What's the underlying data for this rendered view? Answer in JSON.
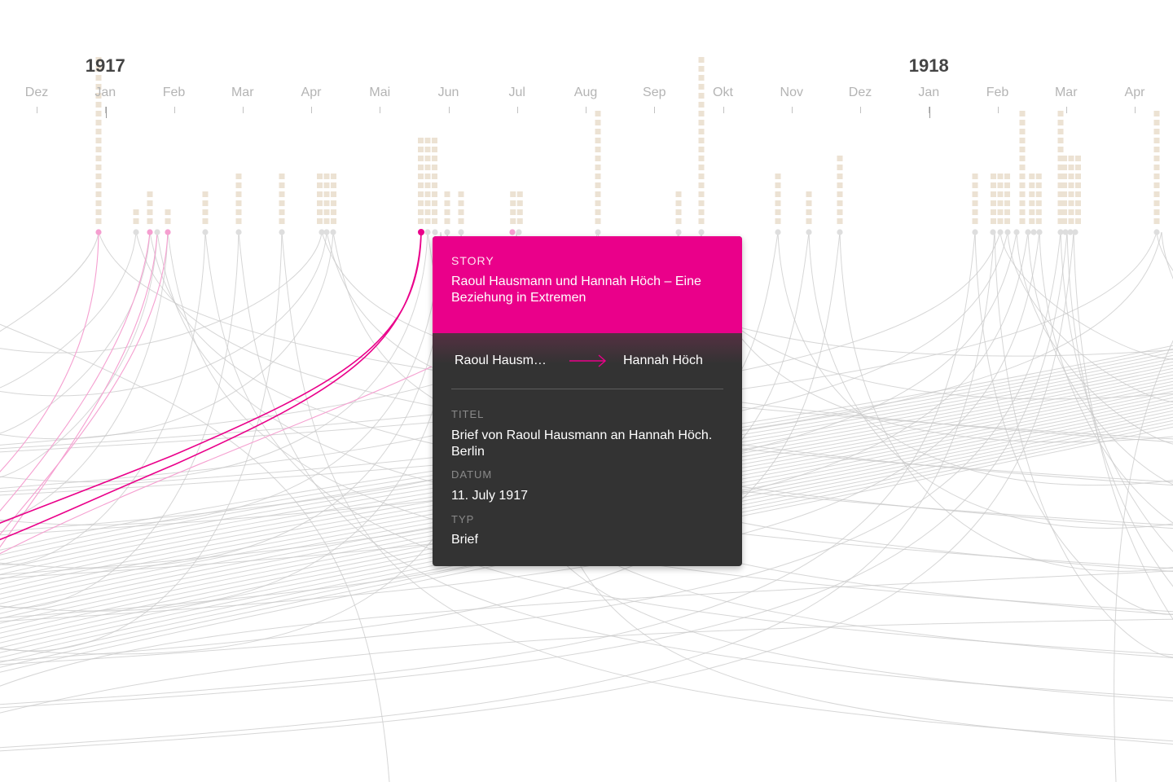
{
  "timeline": {
    "years": [
      {
        "label": "1917",
        "month_index": 1
      },
      {
        "label": "1918",
        "month_index": 13
      }
    ],
    "months": [
      "Dez",
      "Jan",
      "Feb",
      "Mar",
      "Apr",
      "Mai",
      "Jun",
      "Jul",
      "Aug",
      "Sep",
      "Okt",
      "Nov",
      "Dez",
      "Jan",
      "Feb",
      "Mar",
      "Apr"
    ]
  },
  "colors": {
    "accent": "#ea008a",
    "accent_light": "#f59fd0",
    "line_gray": "#c8c8c8",
    "square_beige": "#ece2d3",
    "card_dark": "#333333"
  },
  "tooltip": {
    "story_kicker": "STORY",
    "story_title": "Raoul Hausmann und Hannah Höch – Eine Beziehung in Extremen",
    "sender": "Raoul Hausm…",
    "recipient": "Hannah Höch",
    "arrow_icon": "arrow-right",
    "title_label": "TITEL",
    "title_value": "Brief von Raoul Hausmann an Hannah Höch. Berlin",
    "date_label": "DATUM",
    "date_value": "11. July 1917",
    "type_label": "TYP",
    "type_value": "Brief"
  }
}
